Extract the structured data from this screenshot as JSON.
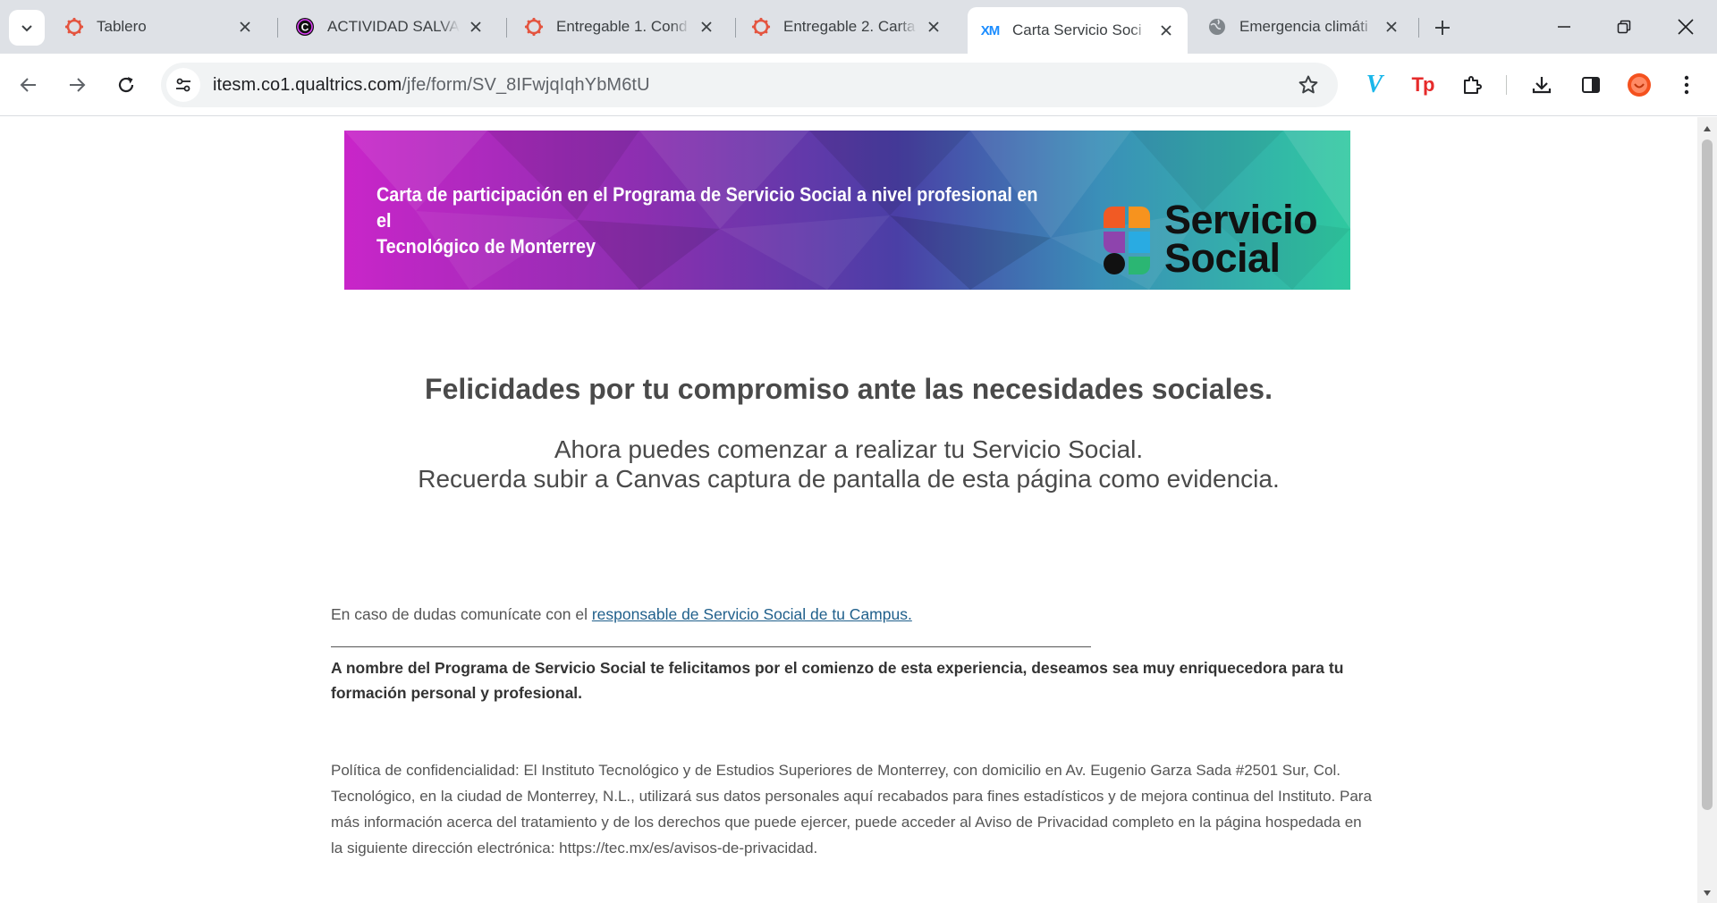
{
  "tabs": [
    {
      "title": "Tablero",
      "icon": "canvas-icon",
      "active": false
    },
    {
      "title": "ACTIVIDAD SALVA",
      "icon": "circle-c-icon",
      "active": false
    },
    {
      "title": "Entregable 1. Cond",
      "icon": "canvas-icon",
      "active": false
    },
    {
      "title": "Entregable 2. Carta",
      "icon": "canvas-icon",
      "active": false
    },
    {
      "title": "Carta Servicio Soci",
      "icon": "qualtrics-xm-icon",
      "active": true
    },
    {
      "title": "Emergencia climáti",
      "icon": "globe-icon",
      "active": false
    }
  ],
  "tab_favicon_text": {
    "xm": "XM"
  },
  "address_bar": {
    "host": "itesm.co1.qualtrics.com",
    "path": "/jfe/form/SV_8IFwjqIqhYbM6tU"
  },
  "extensions": [
    {
      "name": "vimeo-extension-icon",
      "glyph": "V",
      "color": "#1ab7ea"
    },
    {
      "name": "tp-extension-icon",
      "glyph": "Tp",
      "color": "#e62b2b"
    }
  ],
  "banner": {
    "title_line1": "Carta de participación en el Programa de Servicio Social a nivel profesional en el",
    "title_line2": "Tecnológico de Monterrey",
    "logo_line1": "Servicio",
    "logo_line2": "Social",
    "logo_colors": [
      "#f15a24",
      "#f7931e",
      "#8e44ad",
      "#29abe2",
      "#111111",
      "#2bb673"
    ]
  },
  "content": {
    "heading": "Felicidades por tu compromiso ante las necesidades sociales.",
    "sub1": "Ahora puedes comenzar a realizar tu Servicio Social.",
    "sub2": "Recuerda subir a Canvas captura de pantalla de esta página como evidencia.",
    "contact_prefix": "En caso de dudas comunícate con el ",
    "contact_link": "responsable de Servicio Social de tu Campus.",
    "closing": "A nombre del Programa de Servicio Social te felicitamos por el comienzo de esta experiencia, deseamos sea muy enriquecedora para tu formación personal y profesional.",
    "privacy": "Política de confidencialidad: El Instituto Tecnológico y de Estudios Superiores de Monterrey, con domicilio en Av. Eugenio Garza Sada #2501 Sur, Col. Tecnológico, en la ciudad de Monterrey, N.L., utilizará sus datos personales aquí recabados para fines estadísticos y de mejora continua del Instituto. Para más información acerca del tratamiento y de los derechos que puede ejercer, puede acceder al Aviso de Privacidad completo en la página hospedada en la siguiente dirección electrónica: https://tec.mx/es/avisos-de-privacidad."
  },
  "colors": {
    "canvas_red": "#e4543f",
    "link": "#1f5f8b",
    "text": "#4a4a4a"
  }
}
